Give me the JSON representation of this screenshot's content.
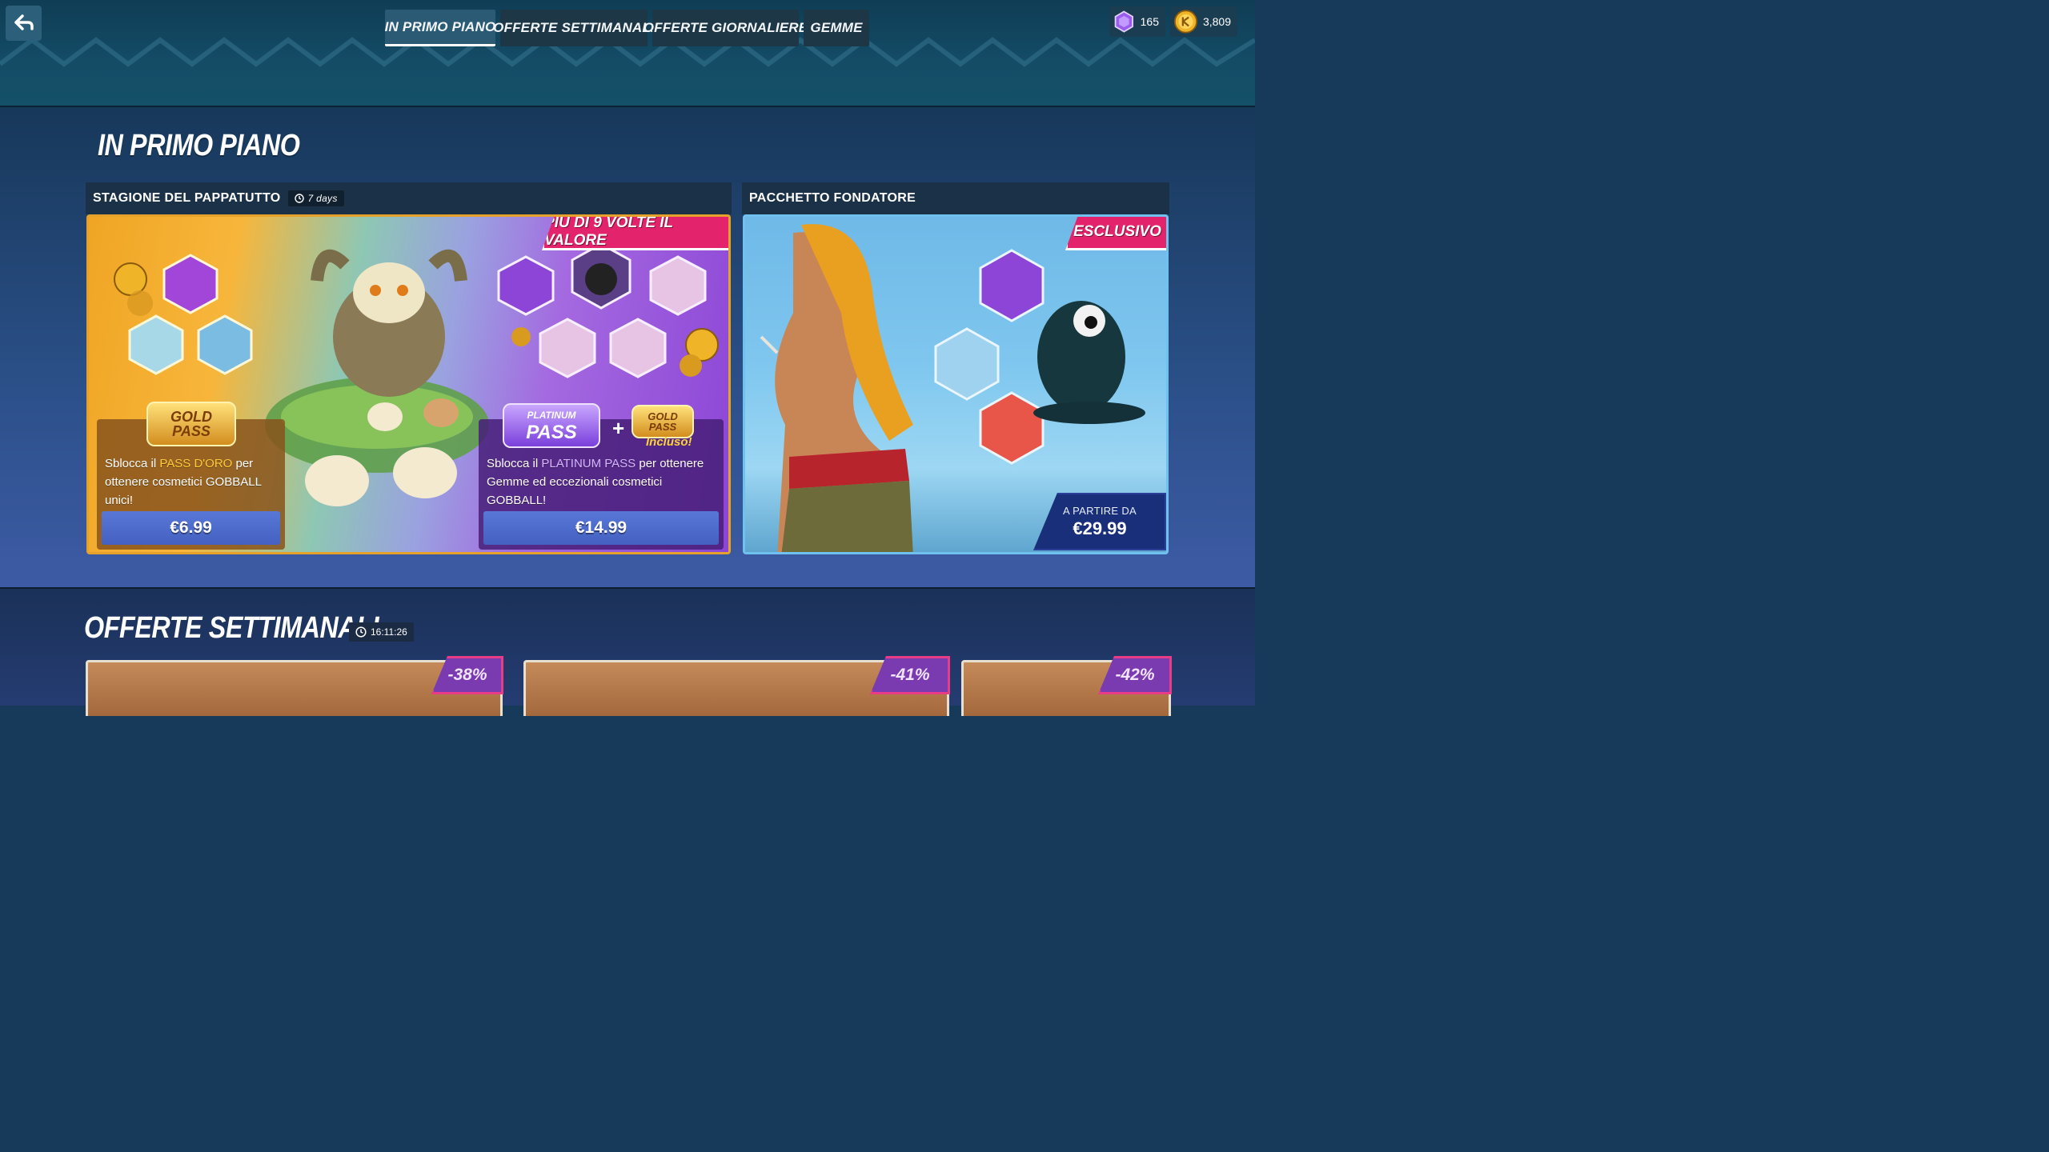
{
  "nav": {
    "tabs": [
      {
        "label": "IN PRIMO PIANO",
        "active": true
      },
      {
        "label": "OFFERTE SETTIMANALI",
        "active": false
      },
      {
        "label": "OFFERTE GIORNALIERE",
        "active": false
      },
      {
        "label": "GEMME",
        "active": false
      }
    ]
  },
  "currency": {
    "gems": "165",
    "coins": "3,809"
  },
  "featured": {
    "title": "IN PRIMO PIANO",
    "season_card": {
      "header": "STAGIONE DEL PAPPATUTTO",
      "timer": "7 days",
      "ribbon": "PIÙ DI 9 VOLTE IL VALORE",
      "gold_offer": {
        "badge_line1": "GOLD",
        "badge_line2": "PASS",
        "desc_pre": "Sblocca il ",
        "desc_highlight": "PASS D'ORO",
        "desc_post": " per ottenere cosmetici GOBBALL unici!",
        "price": "€6.99"
      },
      "platinum_offer": {
        "badge_line1": "PLATINUM",
        "badge_line2": "PASS",
        "plus": "+",
        "included_badge_line1": "GOLD",
        "included_badge_line2": "PASS",
        "included": "Incluso!",
        "desc_pre": "Sblocca il ",
        "desc_highlight": "PLATINUM PASS",
        "desc_post": " per ottenere Gemme ed eccezionali cosmetici GOBBALL!",
        "price": "€14.99"
      }
    },
    "founder_card": {
      "header": "PACCHETTO FONDATORE",
      "ribbon": "ESCLUSIVO",
      "price_prefix": "A PARTIRE DA",
      "price": "€29.99"
    }
  },
  "weekly": {
    "title": "OFFERTE SETTIMANALI",
    "timer": "16:11:26",
    "deals": [
      {
        "discount": "-38%"
      },
      {
        "discount": "-41%"
      },
      {
        "discount": "-42%"
      }
    ]
  },
  "colors": {
    "ribbon": "#e3236c",
    "price_button": "#4966c7",
    "gold_highlight": "#ffcb3b",
    "gem": "#9b5cf0",
    "coin": "#f0b428"
  }
}
